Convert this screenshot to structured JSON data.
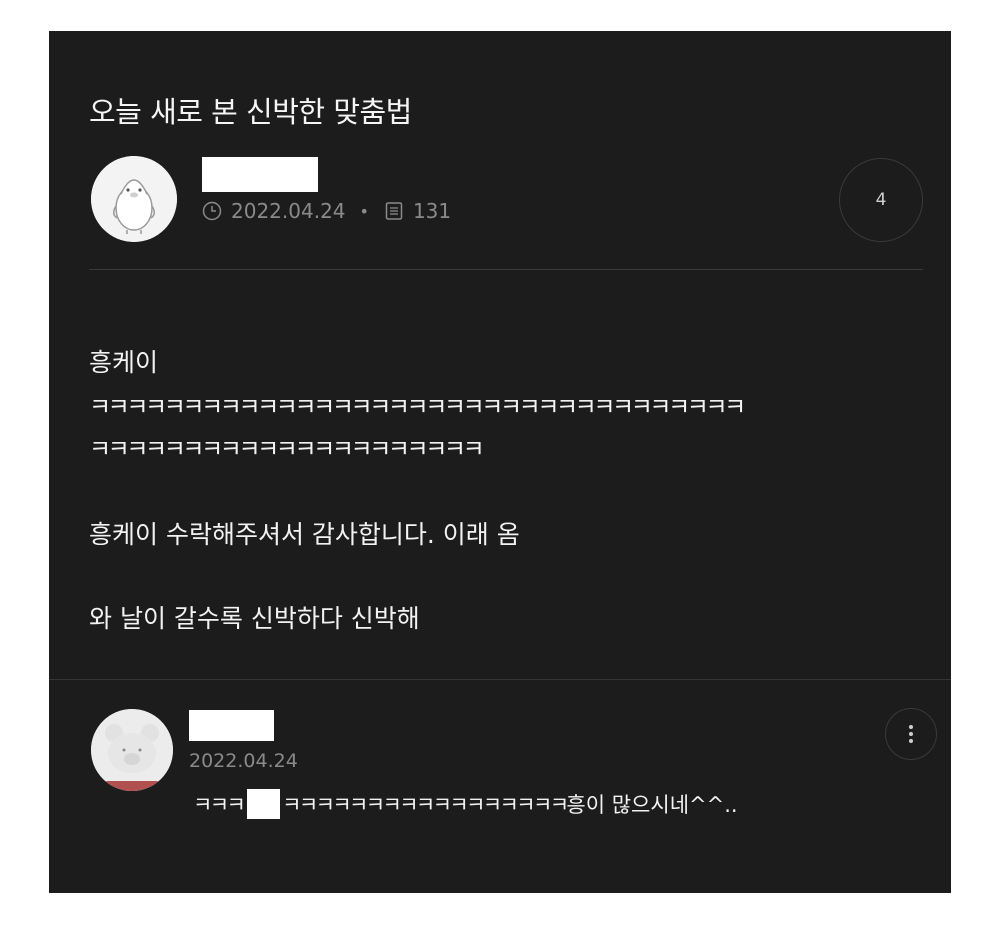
{
  "post": {
    "title": "오늘 새로 본 신박한 맞춤법",
    "date": "2022.04.24",
    "views": "131",
    "comment_count": "4",
    "body": {
      "line1": "흥케이",
      "line2": "ㅋㅋㅋㅋㅋㅋㅋㅋㅋㅋㅋㅋㅋㅋㅋㅋㅋㅋㅋㅋㅋㅋㅋㅋㅋㅋㅋㅋㅋㅋㅋㅋㅋㅋㅋ",
      "line3": "ㅋㅋㅋㅋㅋㅋㅋㅋㅋㅋㅋㅋㅋㅋㅋㅋㅋㅋㅋㅋㅋ",
      "line4": "흥케이 수락해주셔서 감사합니다. 이래 옴",
      "line5": "와 날이 갈수록 신박하다 신박해"
    }
  },
  "comment": {
    "date": "2022.04.24",
    "text_prefix": "ㅋㅋㅋ",
    "text_suffix_laugh": "ㅋㅋㅋㅋㅋㅋㅋㅋㅋㅋㅋㅋㅋㅋㅋㅋㅋ",
    "text_suffix": "흥이 많으시네^^.."
  },
  "icons": {
    "date": "clock-icon",
    "views": "document-icon",
    "more": "more-vertical-icon",
    "author_avatar": "penguin-avatar",
    "comment_avatar": "bear-avatar"
  },
  "colors": {
    "background": "#1c1c1c",
    "text": "#f2f2f2",
    "muted": "#8a8a8a",
    "border": "#3a3a3a"
  }
}
